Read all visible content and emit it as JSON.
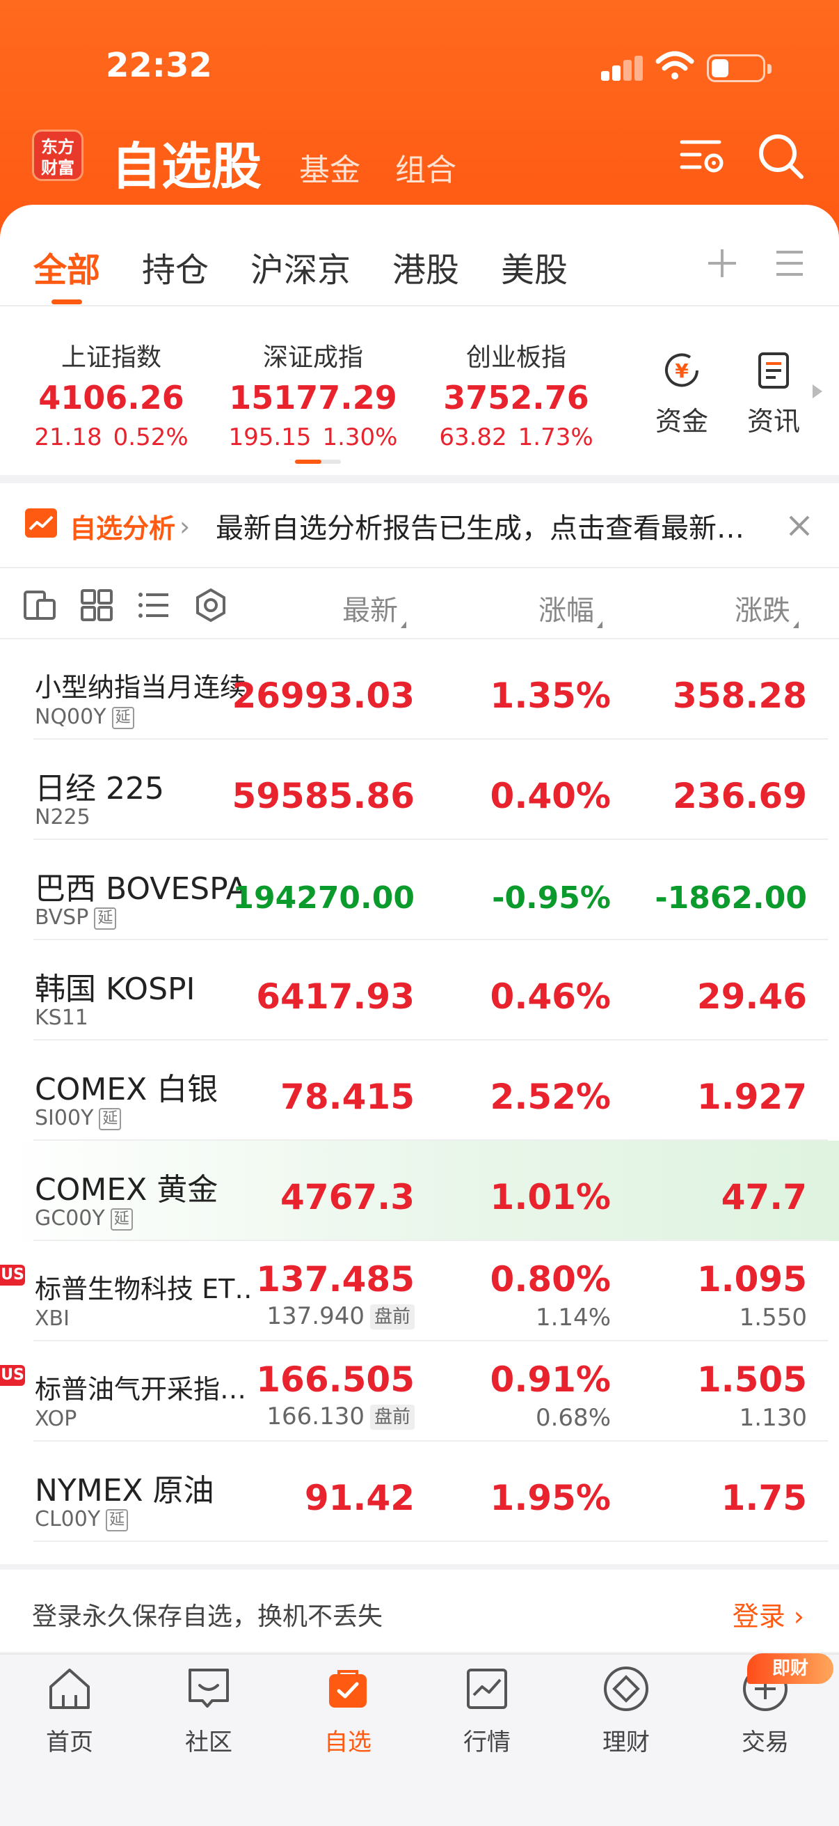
{
  "status": {
    "time": "22:32"
  },
  "header": {
    "logo": [
      "东方",
      "财富"
    ],
    "title": "自选股",
    "subtabs": [
      "基金",
      "组合"
    ]
  },
  "tabs": [
    "全部",
    "持仓",
    "沪深京",
    "港股",
    "美股"
  ],
  "indices": [
    {
      "name": "上证指数",
      "value": "4106.26",
      "change": "21.18",
      "pct": "0.52%"
    },
    {
      "name": "深证成指",
      "value": "15177.29",
      "change": "195.15",
      "pct": "1.30%"
    },
    {
      "name": "创业板指",
      "value": "3752.76",
      "change": "63.82",
      "pct": "1.73%"
    }
  ],
  "side_buttons": [
    {
      "label": "资金",
      "icon": "yuan-circle-icon"
    },
    {
      "label": "资讯",
      "icon": "news-icon"
    }
  ],
  "banner": {
    "tag": "自选分析",
    "text": "最新自选分析报告已生成，点击查看最新…"
  },
  "columns": [
    "最新",
    "涨幅",
    "涨跌"
  ],
  "rows": [
    {
      "name": "小型纳指当月连续",
      "code": "NQ00Y",
      "delay": "延",
      "last": "26993.03",
      "pct": "1.35%",
      "chg": "358.28",
      "dir": "up"
    },
    {
      "name": "日经 225",
      "code": "N225",
      "last": "59585.86",
      "pct": "0.40%",
      "chg": "236.69",
      "dir": "up"
    },
    {
      "name": "巴西 BOVESPA",
      "code": "BVSP",
      "delay": "延",
      "last": "194270.00",
      "pct": "-0.95%",
      "chg": "-1862.00",
      "dir": "down"
    },
    {
      "name": "韩国 KOSPI",
      "code": "KS11",
      "last": "6417.93",
      "pct": "0.46%",
      "chg": "29.46",
      "dir": "up"
    },
    {
      "name": "COMEX 白银",
      "code": "SI00Y",
      "delay": "延",
      "last": "78.415",
      "pct": "2.52%",
      "chg": "1.927",
      "dir": "up"
    },
    {
      "name": "COMEX 黄金",
      "code": "GC00Y",
      "delay": "延",
      "last": "4767.3",
      "pct": "1.01%",
      "chg": "47.7",
      "dir": "up"
    },
    {
      "name": "标普生物科技 ET…",
      "code": "XBI",
      "badge": "US",
      "last": "137.485",
      "pct": "0.80%",
      "chg": "1.095",
      "dir": "up",
      "pre_last": "137.940",
      "pre_label": "盘前",
      "pre_pct": "1.14%",
      "pre_chg": "1.550"
    },
    {
      "name": "标普油气开采指…",
      "code": "XOP",
      "badge": "US",
      "last": "166.505",
      "pct": "0.91%",
      "chg": "1.505",
      "dir": "up",
      "pre_last": "166.130",
      "pre_label": "盘前",
      "pre_pct": "0.68%",
      "pre_chg": "1.130"
    },
    {
      "name": "NYMEX 原油",
      "code": "CL00Y",
      "delay": "延",
      "last": "91.42",
      "pct": "1.95%",
      "chg": "1.75",
      "dir": "up"
    }
  ],
  "login": {
    "text": "登录永久保存自选，换机不丢失",
    "link": "登录"
  },
  "nav": [
    "首页",
    "社区",
    "自选",
    "行情",
    "理财",
    "交易"
  ],
  "promo": "即财",
  "colors": {
    "brand": "#ff5a12",
    "up": "#e8232d",
    "down": "#0b9a2c"
  }
}
